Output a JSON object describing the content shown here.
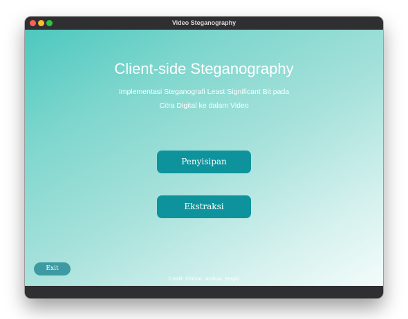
{
  "window": {
    "title": "Video Steganography"
  },
  "main": {
    "title": "Client-side Steganography",
    "subtitle_line1": "Implementasi Steganografi Least Significant Bit pada",
    "subtitle_line2": "Citra Digital ke dalam Video",
    "embed_label": "Penyisipan",
    "extract_label": "Ekstraksi"
  },
  "footer": {
    "exit_label": "Exit",
    "credit": "Credit: Christo, Joshua, Sergio"
  },
  "colors": {
    "gradient_start": "#4dc8bf",
    "gradient_end": "#f3fcfa",
    "button": "#0e939c",
    "exit_button": "#3d9aa2"
  }
}
